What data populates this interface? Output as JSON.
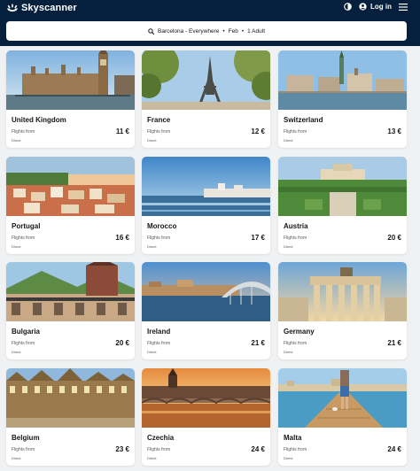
{
  "header": {
    "brand": "Skyscanner",
    "login_label": "Log in",
    "icons": [
      "skyscanner-sun-icon",
      "theme-toggle-icon",
      "user-icon",
      "menu-icon"
    ]
  },
  "search": {
    "origin": "Barcelona - Everywhere",
    "date": "Feb",
    "travellers": "1 Adult",
    "separator": "•"
  },
  "colors": {
    "header_bg": "#05203c",
    "page_bg": "#eff1f2",
    "card_bg": "#ffffff"
  },
  "destinations": [
    {
      "name": "United Kingdom",
      "price": "11 €",
      "label": "Flights from",
      "note": "Direct"
    },
    {
      "name": "France",
      "price": "12 €",
      "label": "Flights from",
      "note": "Direct"
    },
    {
      "name": "Switzerland",
      "price": "13 €",
      "label": "Flights from",
      "note": "Direct"
    },
    {
      "name": "Portugal",
      "price": "16 €",
      "label": "Flights from",
      "note": "Direct"
    },
    {
      "name": "Morocco",
      "price": "17 €",
      "label": "Flights from",
      "note": "Direct"
    },
    {
      "name": "Austria",
      "price": "20 €",
      "label": "Flights from",
      "note": "Direct"
    },
    {
      "name": "Bulgaria",
      "price": "20 €",
      "label": "Flights from",
      "note": "Direct"
    },
    {
      "name": "Ireland",
      "price": "21 €",
      "label": "Flights from",
      "note": "Direct"
    },
    {
      "name": "Germany",
      "price": "21 €",
      "label": "Flights from",
      "note": "Direct"
    },
    {
      "name": "Belgium",
      "price": "23 €",
      "label": "Flights from",
      "note": "Direct"
    },
    {
      "name": "Czechia",
      "price": "24 €",
      "label": "Flights from",
      "note": "Direct"
    },
    {
      "name": "Malta",
      "price": "24 €",
      "label": "Flights from",
      "note": "Direct"
    }
  ]
}
